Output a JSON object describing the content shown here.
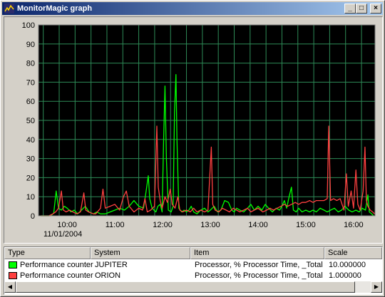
{
  "window": {
    "title": "MonitorMagic graph",
    "icon": "monitormagic-app-icon",
    "controls": {
      "minimize": "_",
      "maximize": "□",
      "close": "×"
    }
  },
  "chart_data": {
    "type": "line",
    "ylim": [
      0,
      100
    ],
    "yticks": [
      0,
      10,
      20,
      30,
      40,
      50,
      60,
      70,
      80,
      90,
      100
    ],
    "xlabel": "",
    "ylabel": "",
    "background": "#000000",
    "grid": true,
    "grid_color": "#2e8b57",
    "x_ticks": [
      {
        "time": "10:00",
        "date": "11/01/2004"
      },
      {
        "time": "11:00"
      },
      {
        "time": "12:00"
      },
      {
        "time": "13:00"
      },
      {
        "time": "14:00"
      },
      {
        "time": "15:00"
      },
      {
        "time": "16:00"
      }
    ],
    "x_range_hours": [
      9.4,
      16.45
    ],
    "series": [
      {
        "name": "JUPITER",
        "color": "#00ff00",
        "points": [
          [
            9.45,
            0
          ],
          [
            9.55,
            0
          ],
          [
            9.62,
            0
          ],
          [
            9.68,
            0.5
          ],
          [
            9.72,
            1.5
          ],
          [
            9.77,
            13
          ],
          [
            9.82,
            4
          ],
          [
            9.88,
            3
          ],
          [
            9.94,
            5
          ],
          [
            10.0,
            4
          ],
          [
            10.08,
            2
          ],
          [
            10.15,
            3
          ],
          [
            10.22,
            1
          ],
          [
            10.3,
            3
          ],
          [
            10.38,
            5
          ],
          [
            10.46,
            2
          ],
          [
            10.55,
            1
          ],
          [
            10.62,
            2
          ],
          [
            10.7,
            1
          ],
          [
            10.8,
            1
          ],
          [
            10.9,
            2
          ],
          [
            11.0,
            3
          ],
          [
            11.1,
            4
          ],
          [
            11.2,
            3
          ],
          [
            11.3,
            5
          ],
          [
            11.4,
            8
          ],
          [
            11.5,
            5
          ],
          [
            11.6,
            4
          ],
          [
            11.65,
            12
          ],
          [
            11.7,
            21
          ],
          [
            11.73,
            9
          ],
          [
            11.78,
            4
          ],
          [
            11.82,
            3
          ],
          [
            11.86,
            2
          ],
          [
            11.9,
            5
          ],
          [
            11.95,
            6
          ],
          [
            11.99,
            2
          ],
          [
            12.02,
            38
          ],
          [
            12.05,
            68
          ],
          [
            12.08,
            30
          ],
          [
            12.12,
            3
          ],
          [
            12.18,
            2
          ],
          [
            12.22,
            5
          ],
          [
            12.25,
            55
          ],
          [
            12.28,
            74
          ],
          [
            12.3,
            40
          ],
          [
            12.34,
            4
          ],
          [
            12.4,
            2
          ],
          [
            12.45,
            3
          ],
          [
            12.5,
            2
          ],
          [
            12.55,
            3
          ],
          [
            12.6,
            5
          ],
          [
            12.65,
            2
          ],
          [
            12.72,
            1
          ],
          [
            12.8,
            3
          ],
          [
            12.88,
            4
          ],
          [
            12.95,
            2
          ],
          [
            13.0,
            3
          ],
          [
            13.08,
            5
          ],
          [
            13.15,
            2
          ],
          [
            13.22,
            3
          ],
          [
            13.3,
            8
          ],
          [
            13.38,
            7
          ],
          [
            13.45,
            3
          ],
          [
            13.5,
            2
          ],
          [
            13.55,
            4
          ],
          [
            13.62,
            3
          ],
          [
            13.7,
            2
          ],
          [
            13.78,
            4
          ],
          [
            13.85,
            6
          ],
          [
            13.92,
            3
          ],
          [
            14.0,
            5
          ],
          [
            14.08,
            3
          ],
          [
            14.15,
            6
          ],
          [
            14.22,
            4
          ],
          [
            14.3,
            2
          ],
          [
            14.38,
            4
          ],
          [
            14.45,
            3
          ],
          [
            14.5,
            5
          ],
          [
            14.55,
            8
          ],
          [
            14.6,
            4
          ],
          [
            14.65,
            10
          ],
          [
            14.7,
            15
          ],
          [
            14.74,
            3
          ],
          [
            14.8,
            2
          ],
          [
            14.85,
            4
          ],
          [
            14.92,
            2
          ],
          [
            15.0,
            3
          ],
          [
            15.08,
            2
          ],
          [
            15.15,
            3
          ],
          [
            15.22,
            2
          ],
          [
            15.3,
            4
          ],
          [
            15.38,
            3
          ],
          [
            15.45,
            2
          ],
          [
            15.52,
            3
          ],
          [
            15.6,
            4
          ],
          [
            15.68,
            2
          ],
          [
            15.75,
            3
          ],
          [
            15.82,
            5
          ],
          [
            15.9,
            3
          ],
          [
            15.97,
            2
          ],
          [
            16.05,
            3
          ],
          [
            16.12,
            2
          ],
          [
            16.18,
            4
          ],
          [
            16.25,
            3
          ],
          [
            16.3,
            11
          ],
          [
            16.33,
            2
          ],
          [
            16.38,
            1
          ],
          [
            16.42,
            0
          ]
        ]
      },
      {
        "name": "ORION",
        "color": "#ff4040",
        "points": [
          [
            9.45,
            0
          ],
          [
            9.55,
            0
          ],
          [
            9.62,
            0
          ],
          [
            9.7,
            1
          ],
          [
            9.76,
            2
          ],
          [
            9.82,
            4
          ],
          [
            9.88,
            13
          ],
          [
            9.92,
            3
          ],
          [
            9.98,
            2
          ],
          [
            10.05,
            3
          ],
          [
            10.12,
            2
          ],
          [
            10.2,
            1
          ],
          [
            10.28,
            2
          ],
          [
            10.35,
            12
          ],
          [
            10.39,
            3
          ],
          [
            10.45,
            2
          ],
          [
            10.55,
            1
          ],
          [
            10.6,
            1
          ],
          [
            10.7,
            4
          ],
          [
            10.75,
            14
          ],
          [
            10.8,
            4
          ],
          [
            10.9,
            5
          ],
          [
            11.0,
            6
          ],
          [
            11.1,
            3
          ],
          [
            11.18,
            10
          ],
          [
            11.24,
            13
          ],
          [
            11.3,
            5
          ],
          [
            11.4,
            2
          ],
          [
            11.5,
            4
          ],
          [
            11.58,
            3
          ],
          [
            11.63,
            9
          ],
          [
            11.68,
            2
          ],
          [
            11.75,
            3
          ],
          [
            11.83,
            5
          ],
          [
            11.88,
            47
          ],
          [
            11.91,
            15
          ],
          [
            11.95,
            8
          ],
          [
            11.99,
            4
          ],
          [
            12.05,
            10
          ],
          [
            12.1,
            7
          ],
          [
            12.16,
            14
          ],
          [
            12.2,
            6
          ],
          [
            12.26,
            4
          ],
          [
            12.32,
            10
          ],
          [
            12.36,
            3
          ],
          [
            12.42,
            2
          ],
          [
            12.5,
            3
          ],
          [
            12.58,
            2
          ],
          [
            12.65,
            4
          ],
          [
            12.72,
            2
          ],
          [
            12.8,
            3
          ],
          [
            12.88,
            2
          ],
          [
            12.95,
            3
          ],
          [
            13.02,
            36
          ],
          [
            13.05,
            6
          ],
          [
            13.1,
            3
          ],
          [
            13.18,
            2
          ],
          [
            13.25,
            4
          ],
          [
            13.33,
            3
          ],
          [
            13.4,
            2
          ],
          [
            13.48,
            4
          ],
          [
            13.55,
            3
          ],
          [
            13.62,
            2
          ],
          [
            13.7,
            3
          ],
          [
            13.78,
            4
          ],
          [
            13.85,
            2
          ],
          [
            13.92,
            3
          ],
          [
            14.0,
            4
          ],
          [
            14.05,
            3
          ],
          [
            14.1,
            2
          ],
          [
            14.18,
            3
          ],
          [
            14.25,
            4
          ],
          [
            14.32,
            3
          ],
          [
            14.4,
            4
          ],
          [
            14.48,
            5
          ],
          [
            14.55,
            6
          ],
          [
            14.62,
            5
          ],
          [
            14.7,
            6
          ],
          [
            14.78,
            7
          ],
          [
            14.85,
            6
          ],
          [
            14.92,
            7
          ],
          [
            15.0,
            7
          ],
          [
            15.08,
            8
          ],
          [
            15.15,
            7
          ],
          [
            15.22,
            8
          ],
          [
            15.3,
            8
          ],
          [
            15.38,
            8
          ],
          [
            15.45,
            9
          ],
          [
            15.48,
            47
          ],
          [
            15.52,
            8
          ],
          [
            15.58,
            9
          ],
          [
            15.65,
            8
          ],
          [
            15.72,
            9
          ],
          [
            15.8,
            3
          ],
          [
            15.85,
            22
          ],
          [
            15.89,
            5
          ],
          [
            15.95,
            13
          ],
          [
            16.0,
            4
          ],
          [
            16.05,
            24
          ],
          [
            16.09,
            6
          ],
          [
            16.14,
            3
          ],
          [
            16.2,
            13
          ],
          [
            16.24,
            36
          ],
          [
            16.27,
            8
          ],
          [
            16.3,
            5
          ],
          [
            16.35,
            3
          ],
          [
            16.4,
            2
          ],
          [
            16.44,
            1
          ]
        ]
      }
    ]
  },
  "list": {
    "columns": [
      "Type",
      "System",
      "Item",
      "Scale"
    ],
    "rows": [
      {
        "type": "Performance counter",
        "system": "JUPITER",
        "item": "Processor, % Processor Time, _Total",
        "scale": "10.000000",
        "color": "#00ff00"
      },
      {
        "type": "Performance counter",
        "system": "ORION",
        "item": "Processor, % Processor Time, _Total",
        "scale": "1.000000",
        "color": "#ff4040"
      }
    ],
    "scrollbar": {
      "left": "◀",
      "right": "▶"
    }
  }
}
